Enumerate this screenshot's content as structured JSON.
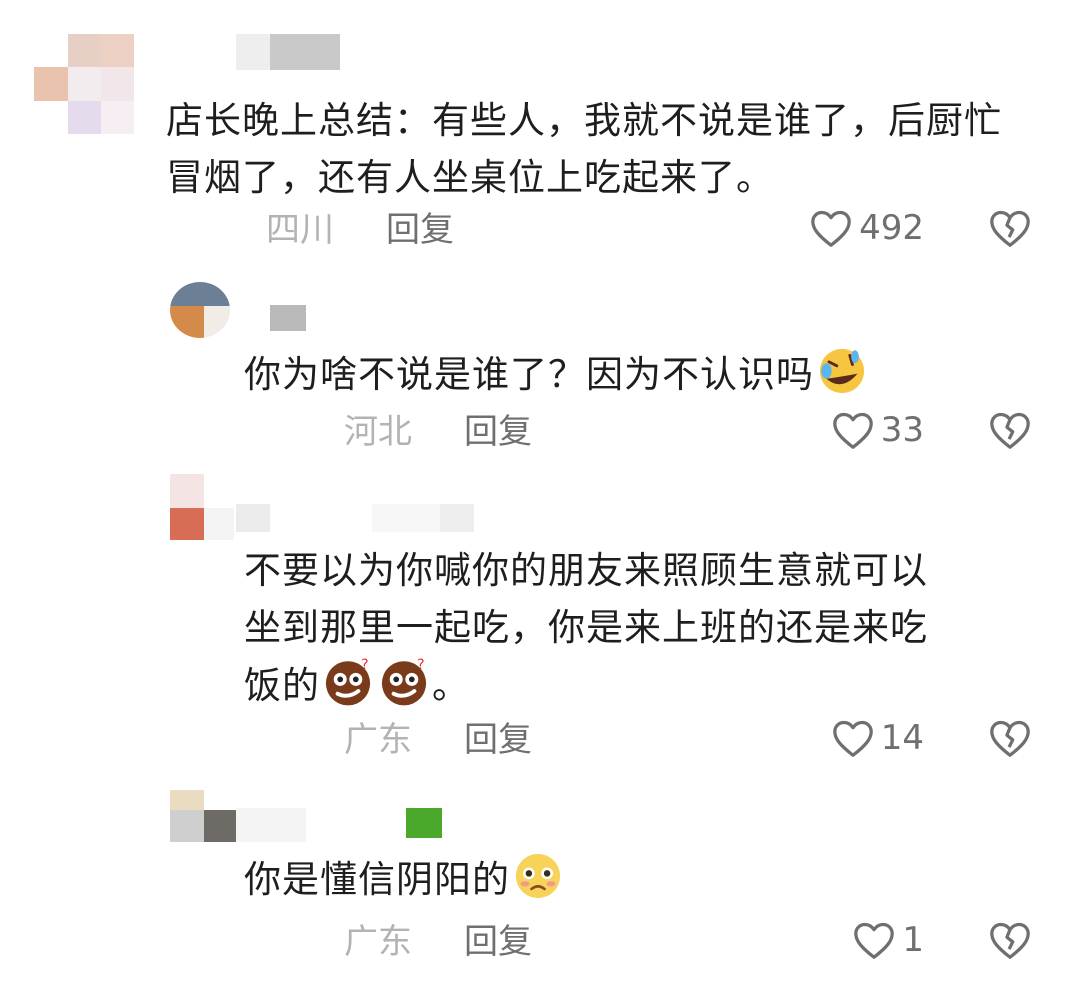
{
  "comments": [
    {
      "text": "店长晚上总结：有些人，我就不说是谁了，后厨忙冒烟了，还有人坐桌位上吃起来了。",
      "region": "四川",
      "reply_label": "回复",
      "likes": "492"
    },
    {
      "text": "你为啥不说是谁了？因为不认识吗",
      "emojis": [
        "rofl-emoji"
      ],
      "region": "河北",
      "reply_label": "回复",
      "likes": "33"
    },
    {
      "text_line1": "不要以为你喊你的朋友来照顾生意就可以",
      "text_line2": "坐到那里一起吃，你是来上班的还是来吃",
      "text_line3_start": "饭的",
      "text_line3_end": "。",
      "emojis": [
        "confused-face-emoji",
        "confused-face-emoji"
      ],
      "region": "广东",
      "reply_label": "回复",
      "likes": "14"
    },
    {
      "text": "你是懂信阴阳的",
      "emojis": [
        "pleading-face-emoji"
      ],
      "region": "广东",
      "reply_label": "回复",
      "likes": "1"
    }
  ],
  "icons": {
    "like": "heart-outline-icon",
    "dislike": "broken-heart-icon"
  },
  "colors": {
    "text": "#1e1e1e",
    "region": "#b3b3b3",
    "reply": "#6f6f6f",
    "icon": "#6f6f6f"
  }
}
